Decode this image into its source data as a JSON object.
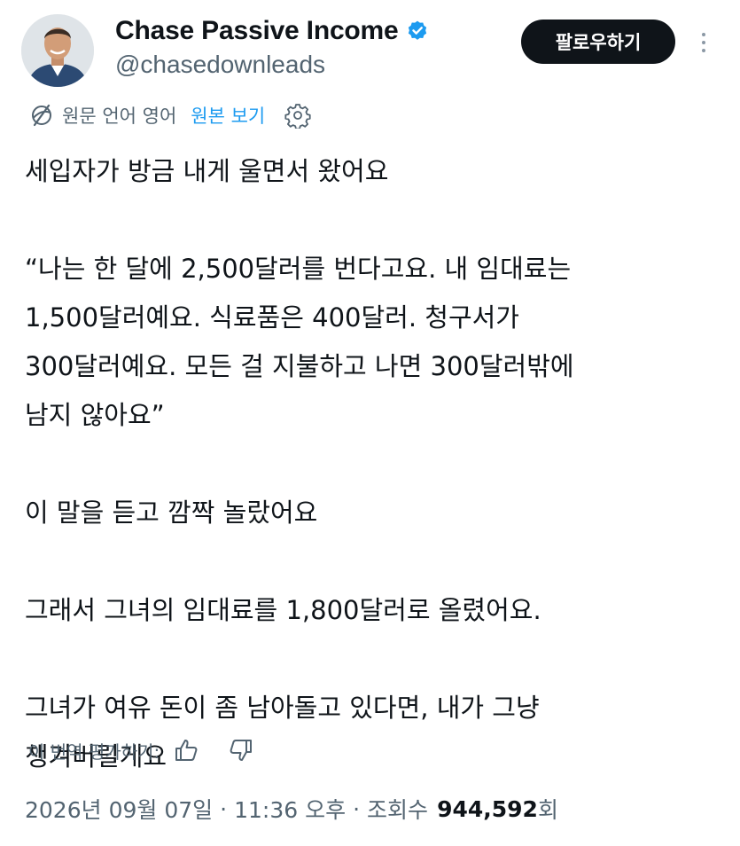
{
  "author": {
    "display_name": "Chase Passive Income",
    "handle": "@chasedownleads",
    "verified_color": "#1d9bf0"
  },
  "header": {
    "follow_label": "팔로우하기",
    "more_icon": "more-vertical-icon"
  },
  "translation": {
    "note": "원문 언어 영어",
    "show_original_label": "원본 보기",
    "icons": [
      "globe-translate-icon",
      "gear-icon"
    ]
  },
  "tweet": {
    "paragraphs": [
      [
        "세입자가 방금 내게 울면서 왔어요"
      ],
      [
        "“나는 한 달에 2,500달러를 번다고요. 내 임대료는",
        "1,500달러예요. 식료품은 400달러. 청구서가",
        "300달러예요. 모든 걸 지불하고 나면 300달러밖에",
        "남지 않아요”"
      ],
      [
        "이 말을 듣고 깜짝 놀랐어요"
      ],
      [
        "그래서 그녀의 임대료를 1,800달러로 올렸어요."
      ],
      [
        "그녀가 여유 돈이 좀 남아돌고 있다면, 내가 그냥",
        "챙겨버릴게요"
      ]
    ]
  },
  "rating": {
    "label": "이 번역 평가하기:",
    "icons": [
      "thumbs-up-icon",
      "thumbs-down-icon"
    ]
  },
  "meta": {
    "date": "2026년 09월 07일",
    "separator": "·",
    "time": "11:36 오후",
    "views_label": "조회수",
    "views_count": "944,592",
    "views_suffix": "회"
  },
  "colors": {
    "text": "#0f1419",
    "secondary": "#536471",
    "accent": "#1d9bf0",
    "button_bg": "#0f1419"
  }
}
